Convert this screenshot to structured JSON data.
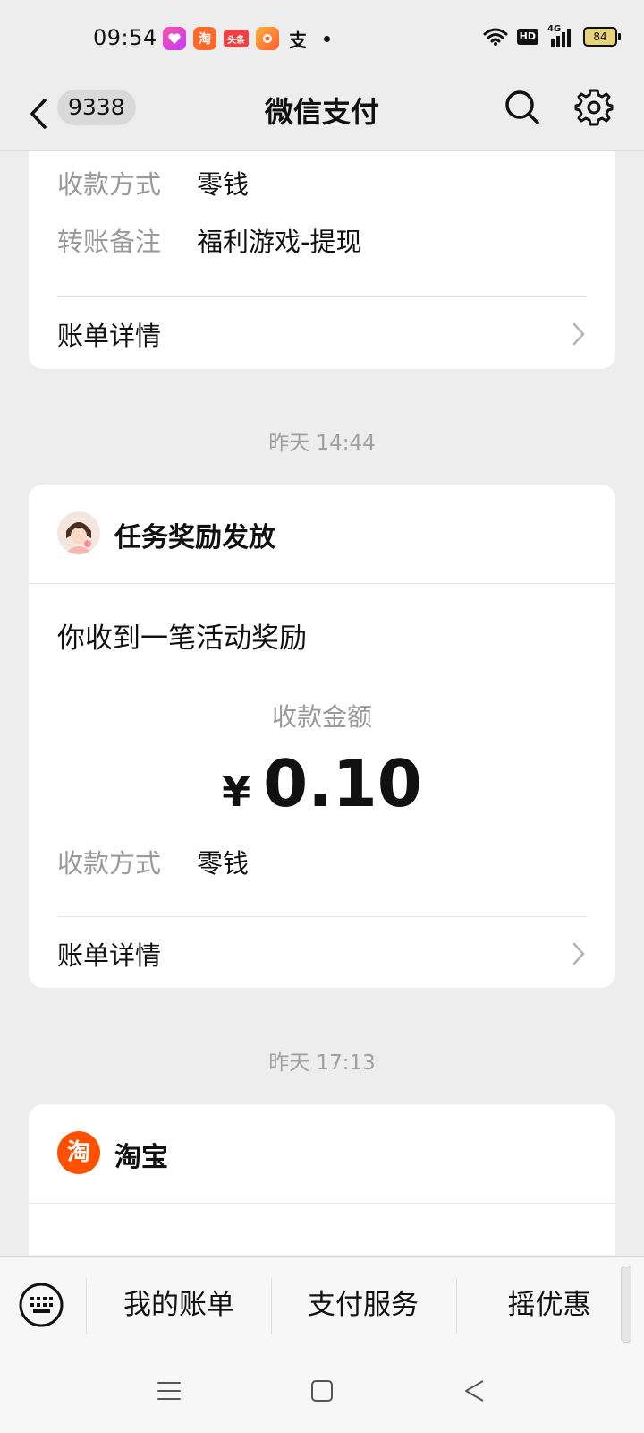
{
  "status_bar": {
    "time": "09:54",
    "apps": [
      "头条"
    ],
    "network": "4G",
    "hd": "HD",
    "battery": "84"
  },
  "navbar": {
    "back_count": "9338",
    "title": "微信支付"
  },
  "card1": {
    "method_label": "收款方式",
    "method_value": "零钱",
    "remark_label": "转账备注",
    "remark_value": "福利游戏-提现",
    "detail_label": "账单详情"
  },
  "time1": "昨天 14:44",
  "card2": {
    "sender": "任务奖励发放",
    "headline": "你收到一笔活动奖励",
    "amount_label": "收款金额",
    "currency": "¥",
    "amount": "0.10",
    "method_label": "收款方式",
    "method_value": "零钱",
    "detail_label": "账单详情"
  },
  "time2": "昨天 17:13",
  "card3": {
    "sender": "淘宝",
    "logo_char": "淘"
  },
  "bottom_menu": {
    "items": [
      "我的账单",
      "支付服务",
      "摇优惠"
    ]
  },
  "colors": {
    "background": "#ededed",
    "card": "#ffffff",
    "taobao_orange": "#ff5000"
  }
}
